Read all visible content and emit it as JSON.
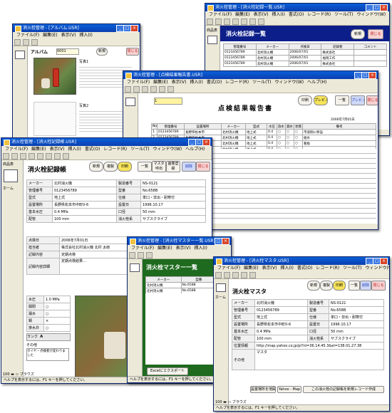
{
  "app": {
    "menu": [
      "ファイル(F)",
      "編集(E)",
      "表示(V)",
      "挿入(I)",
      "書式(O)",
      "レコード(R)",
      "ツール(T)",
      "ウィンドウ(W)",
      "ヘルプ(H)"
    ],
    "status_text": "ヘルプを表示するには、F1 キーを押してください。",
    "side_label_top": "商品表",
    "side_label_bottom": "ホーム"
  },
  "win_list": {
    "title": "消火栓管理 - [消火栓記録一覧.USR]",
    "heading": "消火栓記録一覧",
    "columns": [
      "管理番号",
      "メーカー",
      "点検日",
      "記録者",
      "コメント"
    ],
    "rows": [
      [
        "0123456789",
        "北村消火機",
        "2006/07/01",
        "株式会社",
        ""
      ],
      [
        "0123456789",
        "北村消火機",
        "2006/07/01",
        "福岡工作",
        ""
      ],
      [
        "0123456789",
        "北村消火機",
        "2006/07/01",
        "株式会社",
        ""
      ]
    ],
    "btn_new": "新規",
    "btn_close": "閉じる"
  },
  "win_album": {
    "title": "消火栓管理 - [アルバム.USR]",
    "heading": "アルバム",
    "field": "0001",
    "label_photo": "写真1",
    "label_photo2": "写真2",
    "btn_new": "新規",
    "btn_close": "閉じる"
  },
  "win_report": {
    "title": "消火栓管理 - [点検結果報告書.USR]",
    "heading": "点検結果報告書",
    "field": "1",
    "columns": [
      "No",
      "管理番号",
      "設置場所",
      "メーカー",
      "型式",
      "水圧",
      "放水",
      "漏水",
      "状態",
      "備考"
    ],
    "rows": [
      [
        "1",
        "0123456789",
        "長野県松本市",
        "北村消火機",
        "地上式",
        "0.4",
        "○",
        "○",
        "○",
        "市道側に移設"
      ],
      [
        "2",
        "0123456789",
        "長野県松本市",
        "北村消火機",
        "地上式",
        "0.4",
        "○",
        "○",
        "○",
        "給水"
      ],
      [
        "3",
        "0123456789",
        "長野県松本市",
        "北村消火機",
        "地上式",
        "0.4",
        "○",
        "○",
        "○",
        "看板"
      ],
      [
        "4",
        "0123456789",
        "長野県松本市",
        "北村消火機",
        "地上式",
        "0.4",
        "○",
        "○",
        "○",
        ""
      ]
    ],
    "btn_print": "印刷",
    "btn_preview": "プレビュー",
    "btn_list": "一覧",
    "btn_close": "閉じる",
    "date_text": "2006年7月01日"
  },
  "win_record": {
    "title": "消火栓管理 - [消火栓記録帳.USR]",
    "heading": "消火栓記録帳",
    "buttons": {
      "new": "新規",
      "copy": "複製",
      "print": "印刷",
      "list": "一覧",
      "master": "マスタ呼出",
      "image": "画像登録",
      "delete": "削除",
      "close": "閉じる"
    },
    "fields": [
      [
        "メーカー",
        "北村消火機",
        "製造番号",
        "NS-0121"
      ],
      [
        "管理番号",
        "0123456789",
        "型番",
        "No.658B"
      ],
      [
        "型式",
        "地上式",
        "仕様",
        "単口・非出・耐寒付"
      ],
      [
        "設置場所",
        "長野県松本市中町0-6",
        "設置日",
        "1996.10.17"
      ],
      [
        "基本水圧",
        "0.4 MPa",
        "口径",
        "50 mm"
      ],
      [
        "配管",
        "100 mm",
        "消火栓系",
        "サブスクライブ"
      ]
    ],
    "inspect": [
      [
        "点検日",
        "2006年7月01日"
      ],
      [
        "担当者",
        "株式会社北村消火機 北村 太郎"
      ],
      [
        "記録内容",
        "定期点検"
      ],
      [
        "記録内容詳細",
        "定期点検結果…"
      ]
    ],
    "checks": [
      [
        "水圧",
        "1.0 MPa"
      ],
      [
        "開閉",
        "○"
      ],
      [
        "漏水",
        "○"
      ],
      [
        "錆",
        "×"
      ],
      [
        "排水弁",
        "○"
      ]
    ],
    "rank_label": "ランク",
    "rank_value": "A",
    "other_label": "その他",
    "other_value": "タイヤ・点検者が変わりました",
    "zoom": "100",
    "mode": "ブラウズ"
  },
  "win_master_list": {
    "title": "消火栓管理 - [消火栓マスター一覧.USR]",
    "heading": "消火栓マスター一覧",
    "columns": [
      "メーカー",
      "型番"
    ],
    "rows": [
      [
        "北村消火機",
        "No.658B"
      ],
      [
        "北村消火機",
        "No.658B"
      ]
    ],
    "export_btn": "Excelにエクスポート"
  },
  "win_master": {
    "title": "消火栓管理 - [消火栓マスタ.USR]",
    "heading": "消火栓マスタ",
    "fields": [
      [
        "メーカー",
        "北村消火機",
        "製造番号",
        "NS-0121"
      ],
      [
        "管理番号",
        "0123456789",
        "型番",
        "No.658B"
      ],
      [
        "型式",
        "地上式",
        "仕様",
        "単口・非出・耐寒付"
      ],
      [
        "設置場所",
        "長野県松本市中町0-6",
        "設置日",
        "1996.10.17"
      ],
      [
        "基本水圧",
        "0.4 MPa",
        "口径",
        "50 mm"
      ],
      [
        "配管",
        "100 mm",
        "消火栓系",
        "サブスクライブ"
      ]
    ],
    "map_label": "位置情報",
    "map_url": "http://map.yahoo.co.jp/pl?nl=36.14.45.3&el=138.01.27.38",
    "other_label": "その他",
    "other_value": "マスタ",
    "btn_image": "設置場所を地図",
    "btn_yahoo": "Yahoo - Map",
    "btn_record": "この消火栓の記録帳を新規レコード作成",
    "buttons": {
      "new": "新規",
      "copy": "複製",
      "print": "印刷",
      "list": "一覧",
      "delete": "削除",
      "close": "閉じる"
    },
    "zoom": "100",
    "mode": "ブラウズ"
  }
}
